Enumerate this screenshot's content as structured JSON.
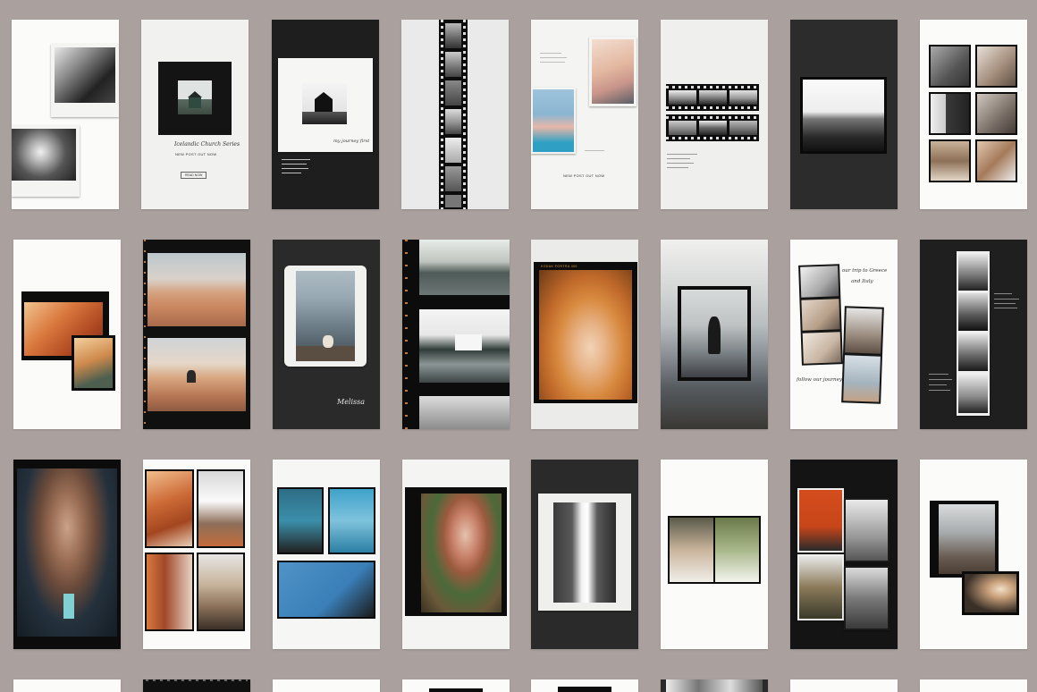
{
  "texts": {
    "r1c2_title": "Icelandic Church Series",
    "r1c2_sub": "NEW POST OUT NOW",
    "r1c2_btn": "READ NOW",
    "r1c3_script": "my journey first",
    "r1c5_sub": "NEW POST OUT NOW",
    "r2c2_script": "Melissa",
    "r2c4_kodak": "KODAK PORTRA 400",
    "r2c7_script1": "our trip to Greece",
    "r2c7_script2": "and Italy",
    "r2c7_script3": "follow our journey"
  },
  "colors": {
    "background": "#aaa19f",
    "white_card": "#fbfbfa",
    "black_card": "#1e1e1e",
    "film_frame": "#0c0c0c",
    "kodak_orange": "#e09a2a"
  }
}
